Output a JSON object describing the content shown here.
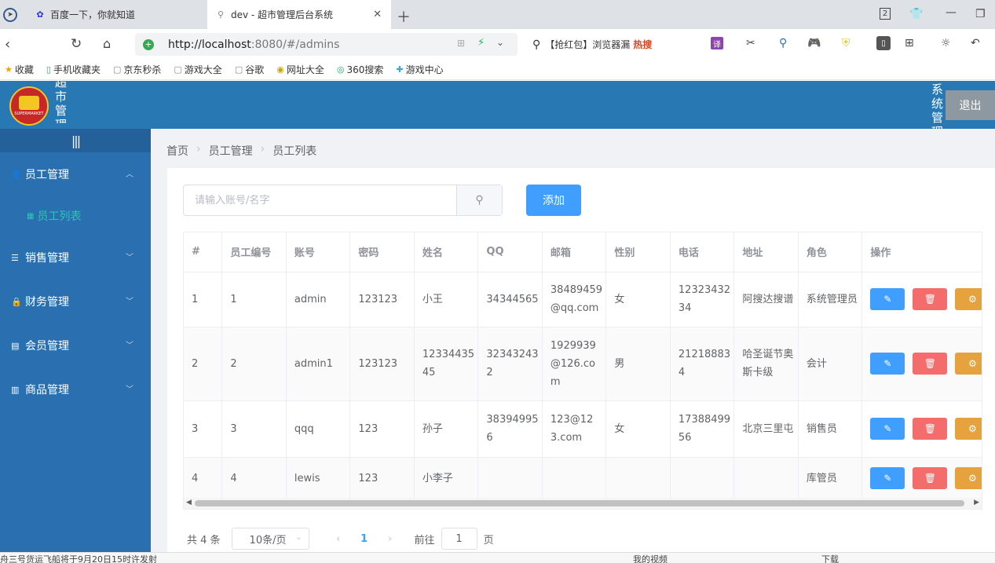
{
  "browser": {
    "tabs": [
      {
        "title": "百度一下，你就知道"
      },
      {
        "title": "dev - 超市管理后台系统"
      }
    ],
    "tab_count": "2",
    "url_host": "http://localhost",
    "url_rest": ":8080/#/admins",
    "search_text": "【抢红包】浏览器漏",
    "hot_label": "热搜",
    "bookmarks": [
      {
        "label": "收藏"
      },
      {
        "label": "手机收藏夹"
      },
      {
        "label": "京东秒杀"
      },
      {
        "label": "游戏大全"
      },
      {
        "label": "谷歌"
      },
      {
        "label": "网址大全"
      },
      {
        "label": "360搜索"
      },
      {
        "label": "游戏中心"
      }
    ],
    "status_news": "舟三号货运飞船将于9月20日15时许发射",
    "status_video": "我的视频",
    "status_download": "下载"
  },
  "header": {
    "app_title": "超市管理系统",
    "system_label": "系统管理",
    "logout_label": "退出",
    "logo_text": "SUPERMARKET"
  },
  "sidebar": {
    "collapse_label": "|||",
    "menus": [
      {
        "label": "员工管理",
        "icon": "user-icon",
        "expanded": true
      },
      {
        "label": "销售管理",
        "icon": "sliders-icon"
      },
      {
        "label": "财务管理",
        "icon": "lock-icon"
      },
      {
        "label": "会员管理",
        "icon": "clipboard-icon"
      },
      {
        "label": "商品管理",
        "icon": "bar-chart-icon"
      }
    ],
    "active_sub": "员工列表"
  },
  "breadcrumb": [
    "首页",
    "员工管理",
    "员工列表"
  ],
  "toolbar": {
    "search_placeholder": "请输入账号/名字",
    "add_label": "添加"
  },
  "table": {
    "columns": [
      "#",
      "员工编号",
      "账号",
      "密码",
      "姓名",
      "QQ",
      "邮箱",
      "性别",
      "电话",
      "地址",
      "角色",
      "操作"
    ],
    "rows": [
      {
        "idx": "1",
        "no": "1",
        "account": "admin",
        "password": "123123",
        "name": "小王",
        "qq": "34344565",
        "email": "38489459@qq.com",
        "gender": "女",
        "phone": "1232343234",
        "address": "阿搜达搜谱",
        "role": "系统管理员"
      },
      {
        "idx": "2",
        "no": "2",
        "account": "admin1",
        "password": "123123",
        "name": "1233443545",
        "qq": "323432432",
        "email": "1929939@126.com",
        "gender": "男",
        "phone": "212188834",
        "address": "哈圣诞节奥斯卡级",
        "role": "会计"
      },
      {
        "idx": "3",
        "no": "3",
        "account": "qqq",
        "password": "123",
        "name": "孙子",
        "qq": "383949956",
        "email": "123@123.com",
        "gender": "女",
        "phone": "1738849956",
        "address": "北京三里屯",
        "role": "销售员"
      },
      {
        "idx": "4",
        "no": "4",
        "account": "lewis",
        "password": "123",
        "name": "小李子",
        "qq": "",
        "email": "",
        "gender": "",
        "phone": "",
        "address": "",
        "role": "库管员"
      }
    ]
  },
  "pagination": {
    "total_label": "共 4 条",
    "page_size": "10条/页",
    "current_page": "1",
    "goto_prefix": "前往",
    "goto_value": "1",
    "goto_suffix": "页"
  },
  "colors": {
    "header_bg": "#2878b4",
    "sidebar_bg": "#2a70b0",
    "primary": "#409eff",
    "danger": "#f56c6c",
    "warning": "#e6a23c",
    "active_sub": "#2ec4b6"
  }
}
